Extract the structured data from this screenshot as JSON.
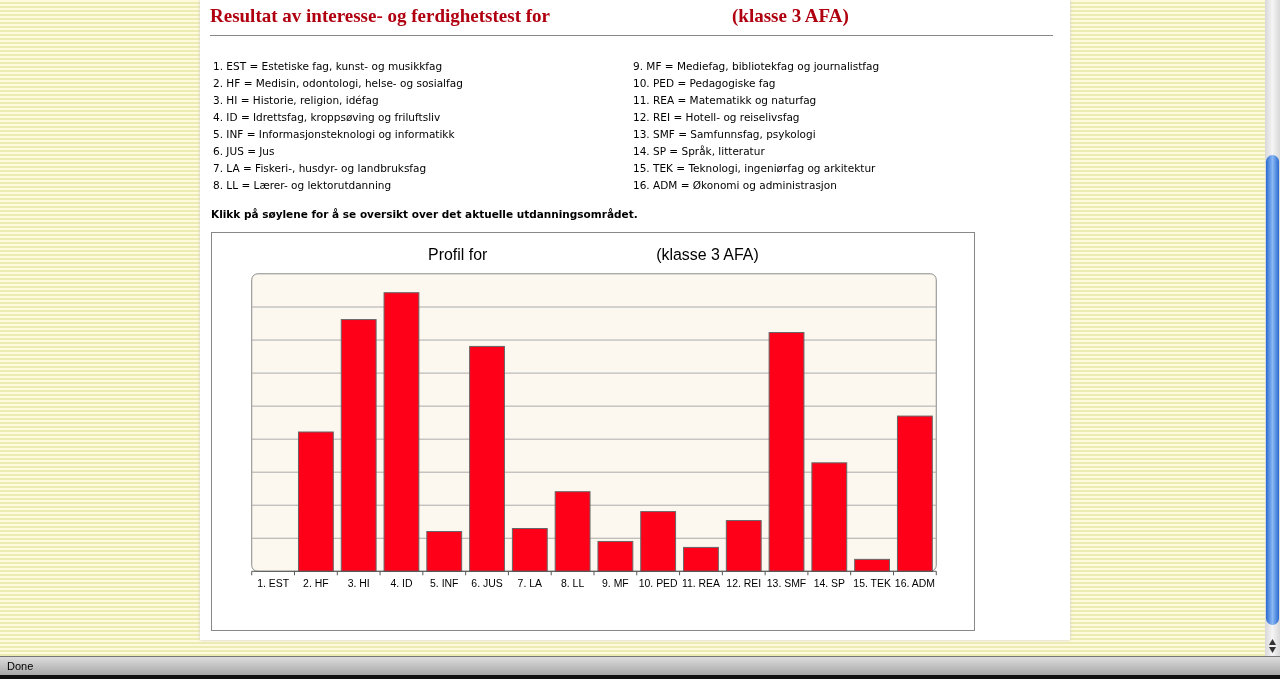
{
  "heading": {
    "text": "Resultat av interesse- og ferdighetstest for",
    "class_label": "(klasse 3 AFA)"
  },
  "legend": [
    "1. EST = Estetiske fag, kunst- og musikkfag",
    "2. HF = Medisin, odontologi, helse- og sosialfag",
    "3. HI = Historie, religion, idéfag",
    "4. ID = Idrettsfag, kroppsøving og friluftsliv",
    "5. INF = Informasjonsteknologi og informatikk",
    "6. JUS = Jus",
    "7. LA = Fiskeri-, husdyr- og landbruksfag",
    "8. LL = Lærer- og lektorutdanning",
    "9. MF = Mediefag, bibliotekfag og journalistfag",
    "10. PED = Pedagogiske fag",
    "11. REA = Matematikk og naturfag",
    "12. REI = Hotell- og reiselivsfag",
    "13. SMF = Samfunnsfag, psykologi",
    "14. SP = Språk, litteratur",
    "15. TEK = Teknologi, ingeniørfag og arkitektur",
    "16. ADM = Økonomi og administrasjon"
  ],
  "instruction": "Klikk på søylene for å se oversikt over det aktuelle utdanningsområdet.",
  "chart": {
    "title": "Profil for",
    "subtitle": "(klasse 3 AFA)",
    "categories": [
      "1. EST",
      "2. HF",
      "3. HI",
      "4. ID",
      "5. INF",
      "6. JUS",
      "7. LA",
      "8. LL",
      "9. MF",
      "10. PED",
      "11. REA",
      "12. REI",
      "13. SMF",
      "14. SP",
      "15. TEK",
      "16. ADM"
    ]
  },
  "status_bar": {
    "text": "Done"
  }
}
